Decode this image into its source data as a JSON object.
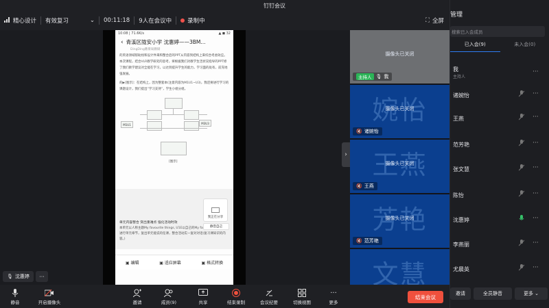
{
  "window": {
    "title": "钉钉会议"
  },
  "toolbar": {
    "app_label": "精心设计",
    "meeting_topic": "有效复习",
    "timer": "00:11:18",
    "participants_count": "9人在会议中",
    "recording": "录制中",
    "fullscreen": "全屏"
  },
  "phone": {
    "status_left": "10:08 | 71.6K/s",
    "status_right": "▲ ◼ 32",
    "title": "青溪区陇安小学 沈惠婷——3BM...",
    "subtitle": "DingDing教育局教研",
    "para1": "的英语领域帮助找和设计件来和整合后的PPT从内容到结构上来综合考虑效应。本次课程，结合VLR教学研究的思考，将根据我们对教学生活状况指导的PPT修了我们教学建议对全能在学习，以达到提升学生的能力，学习面的处有，前充地强发展。",
    "para2": "的▶[图示]：在结构上，因为整套本(注意内容为M1U1~U3)，我还要进行学习的课题设计，我们提出“学习支持”，学生小组分组。",
    "diagram_left": "M1U1",
    "diagram_right": "M3U3",
    "diagram_caption": "[图示]",
    "para3": "单元内容整合 突出重难点 强化活动时效",
    "para4": "本单元以人称主题My favourite things, U1E以自己的My favourite toys, 在进行单元章节，复出单元能说的任课，整合活动实一复对对话(复习课知识的内容。)",
    "bottom_edit": "编辑",
    "bottom_fit": "适应屏幕",
    "bottom_format": "格式转换",
    "float_label": "我正在分享",
    "float_stop": "静音自己"
  },
  "self_label": "沈惠婷",
  "tiles": [
    {
      "big": "",
      "cam": "摄像头已关闭",
      "name": "我",
      "host": "主持人"
    },
    {
      "big": "婉怡",
      "cam": "摄像头已关闭",
      "name": "诸婉怡"
    },
    {
      "big": "王燕",
      "cam": "摄像头已关闭",
      "name": "王燕"
    },
    {
      "big": "芳艳",
      "cam": "摄像头已关闭",
      "name": "范芳艳"
    },
    {
      "big": "文慧",
      "cam": "",
      "name": ""
    }
  ],
  "panel": {
    "title": "管理",
    "search_placeholder": "搜索已入会成员",
    "tab_joined": "已入会(9)",
    "tab_not_joined": "未入会(0)",
    "members": [
      {
        "name": "我",
        "role": "主持人"
      },
      {
        "name": "诸婉怡",
        "role": ""
      },
      {
        "name": "王燕",
        "role": ""
      },
      {
        "name": "范芳艳",
        "role": ""
      },
      {
        "name": "张文慧",
        "role": ""
      },
      {
        "name": "陈怡",
        "role": ""
      },
      {
        "name": "沈惠婷",
        "role": ""
      },
      {
        "name": "李燕丽",
        "role": ""
      },
      {
        "name": "尤晨英",
        "role": ""
      }
    ],
    "btn_invite": "邀请",
    "btn_mute_all": "全员静音",
    "btn_more": "更多"
  },
  "bottom": {
    "mute": "静音",
    "camera": "开启摄像头",
    "invite": "邀请",
    "members": "成员(9)",
    "share": "共享",
    "stop_record": "结束录制",
    "minutes": "会议纪要",
    "switch_view": "切换视图",
    "more": "更多",
    "end_meeting": "结束会议"
  },
  "colors": {
    "end_button": "#f0503d",
    "tile_blue": "#0b3f8f",
    "host_badge": "#2bb457",
    "active_tab_underline": "#2f7df6"
  }
}
